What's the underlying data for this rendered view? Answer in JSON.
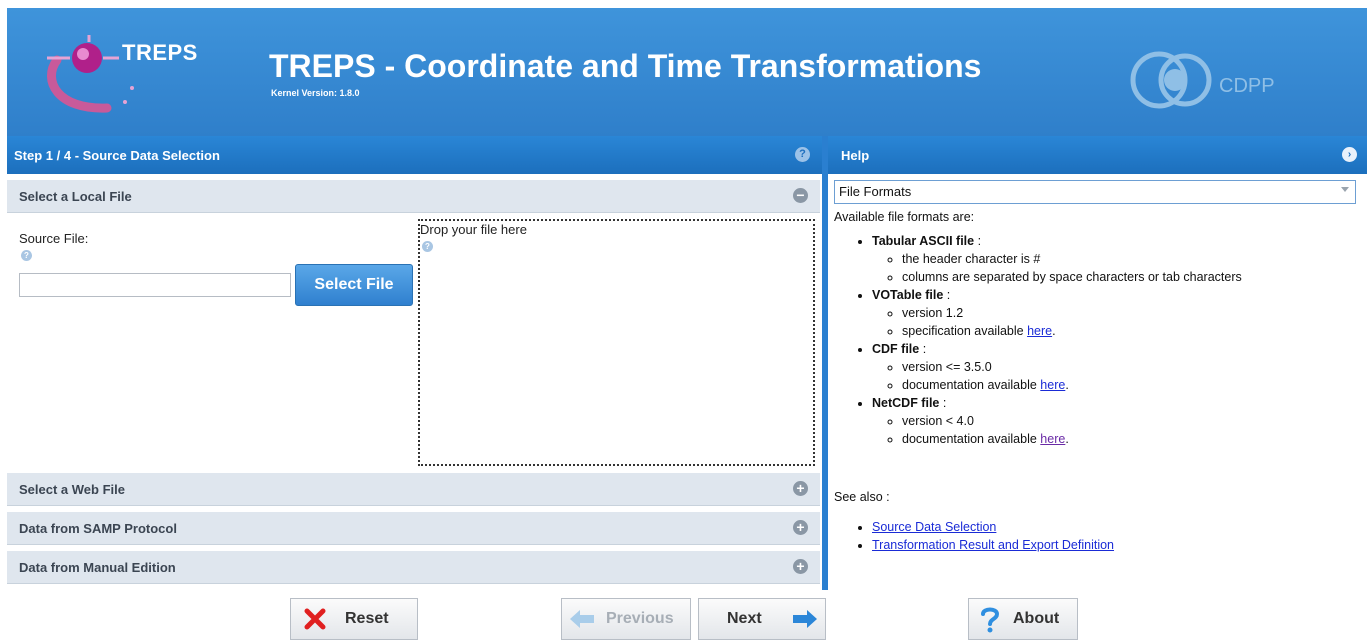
{
  "header": {
    "logo_text": "TREPS",
    "title": "TREPS - Coordinate and Time Transformations",
    "kernel_version": "Kernel Version: 1.8.0",
    "partner_logo_text": "CDPP"
  },
  "wizard": {
    "step_title": "Step 1 / 4 - Source Data Selection",
    "sections": [
      {
        "label": "Select a Local File",
        "expanded": true
      },
      {
        "label": "Select a Web File",
        "expanded": false
      },
      {
        "label": "Data from SAMP Protocol",
        "expanded": false
      },
      {
        "label": "Data from Manual Edition",
        "expanded": false
      }
    ],
    "local_file": {
      "source_label": "Source File:",
      "file_input_value": "",
      "select_button": "Select File",
      "drop_zone_text": "Drop your file here"
    }
  },
  "help": {
    "title": "Help",
    "selected_topic": "File Formats",
    "intro": "Available file formats are:",
    "formats": [
      {
        "name": "Tabular ASCII file",
        "items": [
          {
            "text": "the header character is #"
          },
          {
            "text": "columns are separated by space characters or tab characters"
          }
        ]
      },
      {
        "name": "VOTable file",
        "items": [
          {
            "text": "version 1.2"
          },
          {
            "text": "specification available ",
            "link": "here"
          }
        ]
      },
      {
        "name": "CDF file",
        "items": [
          {
            "text": "version <= 3.5.0"
          },
          {
            "text": "documentation available ",
            "link": "here"
          }
        ]
      },
      {
        "name": "NetCDF file",
        "items": [
          {
            "text": "version < 4.0"
          },
          {
            "text": "documentation available ",
            "link": "here"
          }
        ]
      }
    ],
    "see_also_label": "See also :",
    "see_also_links": [
      "Source Data Selection",
      "Transformation Result and Export Definition"
    ]
  },
  "toolbar": {
    "reset": "Reset",
    "previous": "Previous",
    "next": "Next",
    "about": "About"
  },
  "colors": {
    "header_blue": "#3b8fd6",
    "panel_header_blue": "#1e78c8",
    "accordion_gray": "#dfe6ee",
    "link_blue": "#1a2bd6"
  }
}
